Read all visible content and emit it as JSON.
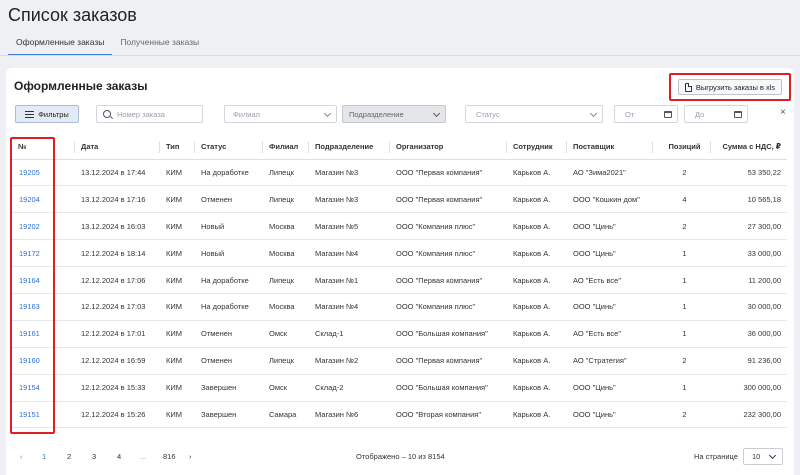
{
  "page": {
    "title": "Список заказов",
    "tabs": [
      {
        "label": "Оформленные заказы",
        "active": true
      },
      {
        "label": "Полученные заказы",
        "active": false
      }
    ]
  },
  "card": {
    "title": "Оформленные заказы",
    "export_label": "Выгрузить заказы в xls"
  },
  "filters": {
    "filters_button": "Фильтры",
    "order_number_placeholder": "Номер заказа",
    "branch_placeholder": "Филиал",
    "subdivision_placeholder": "Подразделение",
    "status_placeholder": "Статус",
    "date_from_placeholder": "От",
    "date_to_placeholder": "До",
    "clear": "×"
  },
  "table": {
    "columns": [
      "№",
      "Дата",
      "Тип",
      "Статус",
      "Филиал",
      "Подразделение",
      "Организатор",
      "Сотрудник",
      "Поставщик",
      "Позиций",
      "Сумма с НДС, ₽"
    ],
    "rows": [
      [
        "19205",
        "13.12.2024 в 17:44",
        "КИМ",
        "На доработке",
        "Липецк",
        "Магазин №3",
        "ООО \"Первая компания\"",
        "Карьков А.",
        "АО \"Зима2021\"",
        "2",
        "53 350,22"
      ],
      [
        "19204",
        "13.12.2024 в 17:16",
        "КИМ",
        "Отменен",
        "Липецк",
        "Магазин №3",
        "ООО \"Первая компания\"",
        "Карьков А.",
        "ООО \"Кошкин дом\"",
        "4",
        "10 565,18"
      ],
      [
        "19202",
        "13.12.2024 в 16:03",
        "КИМ",
        "Новый",
        "Москва",
        "Магазин №5",
        "ООО \"Компания плюс\"",
        "Карьков А.",
        "ООО \"Цинь\"",
        "2",
        "27 300,00"
      ],
      [
        "19172",
        "12.12.2024 в 18:14",
        "КИМ",
        "Новый",
        "Москва",
        "Магазин №4",
        "ООО \"Компания плюс\"",
        "Карьков А.",
        "ООО \"Цинь\"",
        "1",
        "33 000,00"
      ],
      [
        "19164",
        "12.12.2024 в 17:06",
        "КИМ",
        "На доработке",
        "Липецк",
        "Магазин №1",
        "ООО \"Первая компания\"",
        "Карьков А.",
        "АО \"Есть все\"",
        "1",
        "11 200,00"
      ],
      [
        "19163",
        "12.12.2024 в 17:03",
        "КИМ",
        "На доработке",
        "Москва",
        "Магазин №4",
        "ООО \"Компания плюс\"",
        "Карьков А.",
        "ООО \"Цинь\"",
        "1",
        "30 000,00"
      ],
      [
        "19161",
        "12.12.2024 в 17:01",
        "КИМ",
        "Отменен",
        "Омск",
        "Склад-1",
        "ООО \"Большая компания\"",
        "Карьков А.",
        "АО \"Есть все\"",
        "1",
        "36 000,00"
      ],
      [
        "19160",
        "12.12.2024 в 16:59",
        "КИМ",
        "Отменен",
        "Липецк",
        "Магазин №2",
        "ООО \"Первая компания\"",
        "Карьков А.",
        "АО \"Стратегия\"",
        "2",
        "91 236,00"
      ],
      [
        "19154",
        "12.12.2024 в 15:33",
        "КИМ",
        "Завершен",
        "Омск",
        "Склад-2",
        "ООО \"Большая компания\"",
        "Карьков А.",
        "ООО \"Цинь\"",
        "1",
        "300 000,00"
      ],
      [
        "19151",
        "12.12.2024 в 15:26",
        "КИМ",
        "Завершен",
        "Самара",
        "Магазин №6",
        "ООО \"Вторая компания\"",
        "Карьков А.",
        "ООО \"Цинь\"",
        "2",
        "232 300,00"
      ]
    ]
  },
  "pagination": {
    "prev": "‹",
    "pages": [
      "1",
      "2",
      "3",
      "4",
      "...",
      "816"
    ],
    "next": "›",
    "current_page": "1",
    "shown_text": "Отображено – 10 из 8154",
    "per_page_label": "На странице",
    "per_page_value": "10"
  },
  "colors": {
    "accent": "#2f6fd6",
    "highlight_box": "#e02020"
  }
}
